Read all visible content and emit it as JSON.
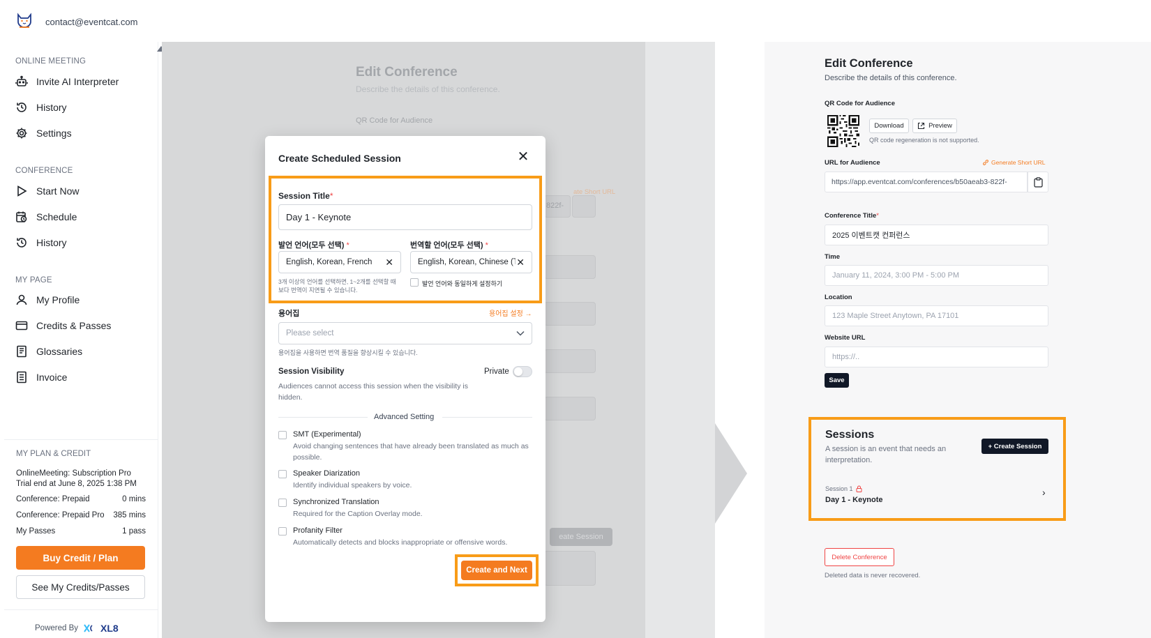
{
  "header": {
    "email": "contact@eventcat.com"
  },
  "sidebar": {
    "sections": [
      {
        "label": "ONLINE MEETING",
        "items": [
          {
            "label": "Invite AI Interpreter",
            "icon": "robot-icon"
          },
          {
            "label": "History",
            "icon": "history-icon"
          },
          {
            "label": "Settings",
            "icon": "gear-icon"
          }
        ]
      },
      {
        "label": "CONFERENCE",
        "items": [
          {
            "label": "Start Now",
            "icon": "play-icon"
          },
          {
            "label": "Schedule",
            "icon": "calendar-clock-icon"
          },
          {
            "label": "History",
            "icon": "history-icon"
          }
        ]
      },
      {
        "label": "MY PAGE",
        "items": [
          {
            "label": "My Profile",
            "icon": "user-icon"
          },
          {
            "label": "Credits & Passes",
            "icon": "card-icon"
          },
          {
            "label": "Glossaries",
            "icon": "book-icon"
          },
          {
            "label": "Invoice",
            "icon": "receipt-icon"
          }
        ]
      }
    ],
    "plan": {
      "label": "MY PLAN & CREDIT",
      "subscription": "OnlineMeeting: Subscription Pro",
      "trial": "Trial end at June 8, 2025 1:38 PM",
      "rows": [
        {
          "name": "Conference: Prepaid",
          "value": "0 mins"
        },
        {
          "name": "Conference: Prepaid Pro",
          "value": "385 mins"
        },
        {
          "name": "My Passes",
          "value": "1 pass"
        }
      ],
      "buy_label": "Buy Credit / Plan",
      "see_label": "See My Credits/Passes"
    },
    "powered_by": "Powered By",
    "brand": "XL8"
  },
  "background": {
    "title": "Edit Conference",
    "desc": "Describe the details of this conference.",
    "qr_label": "QR Code for Audience",
    "short_url": "ate Short URL",
    "url_tail": "822f-",
    "create_session": "eate Session"
  },
  "modal": {
    "title": "Create Scheduled Session",
    "session_title_label": "Session Title",
    "session_title_value": "Day 1 - Keynote",
    "source_lang_label": "발언 언어(모두 선택)",
    "source_lang_value": "English, Korean, French",
    "target_lang_label": "번역할 언어(모두 선택)",
    "target_lang_value": "English, Korean, Chinese (T",
    "lang_hint": "3개 이상의 언어를 선택하면, 1~2개를 선택할 때보다 번역이 지연될 수 있습니다.",
    "same_lang_label": "발언 언어와 동일하게 설정하기",
    "glossary_label": "용어집",
    "glossary_link": "용어집 설정 →",
    "glossary_placeholder": "Please select",
    "glossary_hint": "용어집을 사용하면 번역 품질을 향상시킬 수 있습니다.",
    "visibility_label": "Session Visibility",
    "visibility_value": "Private",
    "visibility_desc": "Audiences cannot access this session when the visibility is hidden.",
    "advanced_label": "Advanced Setting",
    "options": [
      {
        "title": "SMT (Experimental)",
        "desc": "Avoid changing sentences that have already been translated as much as possible."
      },
      {
        "title": "Speaker Diarization",
        "desc": "Identify individual speakers by voice."
      },
      {
        "title": "Synchronized Translation",
        "desc": "Required for the Caption Overlay mode."
      },
      {
        "title": "Profanity Filter",
        "desc": "Automatically detects and blocks inappropriate or offensive words."
      }
    ],
    "submit_label": "Create and Next"
  },
  "right": {
    "title": "Edit Conference",
    "desc": "Describe the details of this conference.",
    "qr_label": "QR Code for Audience",
    "download_label": "Download",
    "preview_label": "Preview",
    "qr_hint": "QR code regeneration is not supported.",
    "url_label": "URL for Audience",
    "short_url_label": "Generate Short URL",
    "url_value": "https://app.eventcat.com/conferences/b50aeab3-822f-",
    "conf_title_label": "Conference Title",
    "conf_title_value": "2025 이벤트캣 컨퍼런스",
    "time_label": "Time",
    "time_value": "January 11, 2024, 3:00 PM - 5:00 PM",
    "location_label": "Location",
    "location_value": "123 Maple Street Anytown, PA 17101",
    "website_label": "Website URL",
    "website_placeholder": "https://..",
    "save_label": "Save",
    "sessions_title": "Sessions",
    "sessions_desc": "A session is an event that needs an interpretation.",
    "create_session_label": "+ Create Session",
    "session_sub": "Session 1",
    "session_name": "Day 1 - Keynote",
    "delete_label": "Delete Conference",
    "delete_hint": "Deleted data is never recovered."
  },
  "colors": {
    "accent": "#f47b20",
    "highlight": "#f89c18",
    "dark_button": "#111827",
    "danger": "#ef4444"
  }
}
